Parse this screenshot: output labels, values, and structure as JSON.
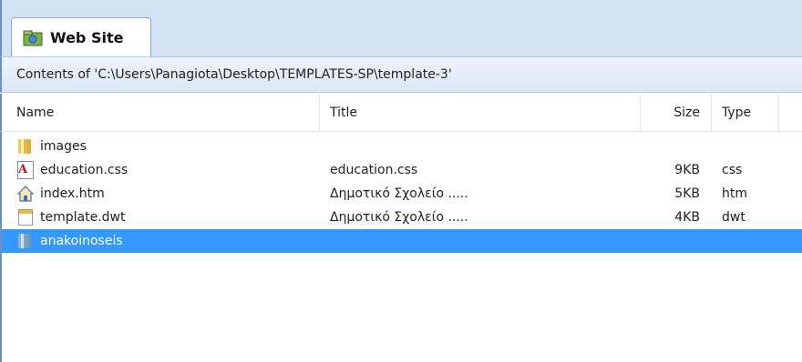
{
  "tab": {
    "label": "Web Site",
    "icon": "website-icon"
  },
  "path_bar": {
    "text": "Contents of 'C:\\Users\\Panagiota\\Desktop\\TEMPLATES-SP\\template-3'"
  },
  "columns": {
    "name": "Name",
    "title": "Title",
    "size": "Size",
    "type": "Type"
  },
  "files": [
    {
      "name": "images",
      "title": "",
      "size": "",
      "type": "",
      "icon": "folder-icon",
      "selected": false
    },
    {
      "name": "education.css",
      "title": "education.css",
      "size": "9KB",
      "type": "css",
      "icon": "css-file-icon",
      "selected": false
    },
    {
      "name": "index.htm",
      "title": "Δημοτικό Σχολείο .....",
      "size": "5KB",
      "type": "htm",
      "icon": "home-page-icon",
      "selected": false
    },
    {
      "name": "template.dwt",
      "title": "Δημοτικό Σχολείο .....",
      "size": "4KB",
      "type": "dwt",
      "icon": "template-file-icon",
      "selected": false
    },
    {
      "name": "anakoinoseis",
      "title": "",
      "size": "",
      "type": "",
      "icon": "folder-icon",
      "selected": true
    }
  ],
  "colors": {
    "selection": "#3399ff",
    "tab_strip": "#d4e2f6",
    "accent_border": "#6c8fc7"
  }
}
